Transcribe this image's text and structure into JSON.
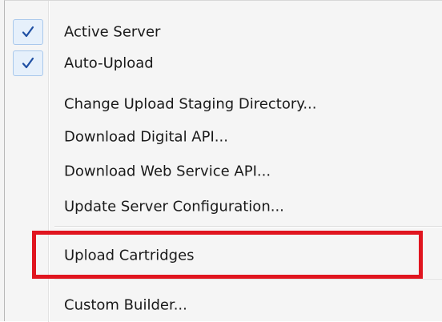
{
  "menu": {
    "items": [
      {
        "label": "Active Server",
        "checked": true
      },
      {
        "label": "Auto-Upload",
        "checked": true
      },
      {
        "label": "Change Upload Staging Directory...",
        "checked": false
      },
      {
        "label": "Download Digital API...",
        "checked": false
      },
      {
        "label": "Download Web Service API...",
        "checked": false
      },
      {
        "label": "Update Server Configuration...",
        "checked": false
      },
      {
        "label": "Upload Cartridges",
        "checked": false,
        "highlighted": true
      },
      {
        "label": "Custom Builder...",
        "checked": false
      }
    ]
  },
  "colors": {
    "menu_background": "#f5f5f5",
    "check_background": "#e6f0fb",
    "check_border": "#a9c8ec",
    "checkmark": "#1f4fa3",
    "highlight_outline": "#e0151f"
  },
  "icons": {
    "check": "check-icon"
  }
}
